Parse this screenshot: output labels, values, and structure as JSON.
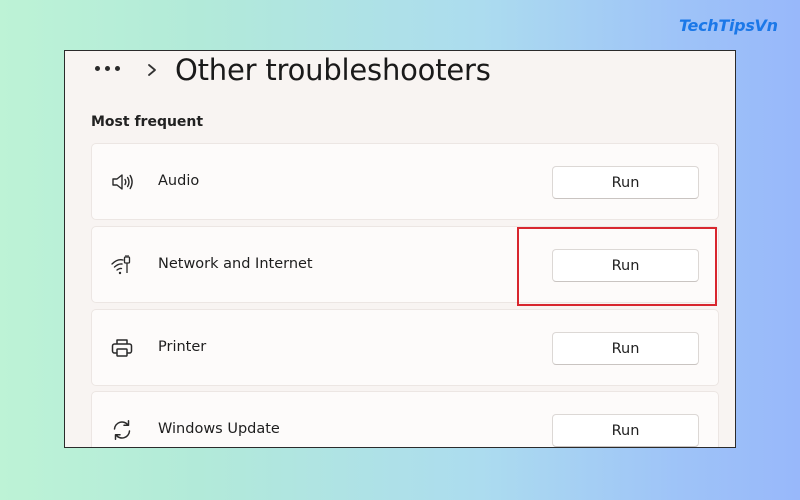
{
  "watermark": {
    "text": "TechTipsVn"
  },
  "header": {
    "more_icon": "more-dots-icon",
    "chevron_icon": "chevron-right-icon",
    "title": "Other troubleshooters"
  },
  "section": {
    "label": "Most frequent"
  },
  "items": [
    {
      "label": "Audio",
      "icon": "speaker-icon",
      "button": "Run"
    },
    {
      "label": "Network and Internet",
      "icon": "wifi-icon",
      "button": "Run"
    },
    {
      "label": "Printer",
      "icon": "printer-icon",
      "button": "Run"
    },
    {
      "label": "Windows Update",
      "icon": "refresh-icon",
      "button": "Run"
    }
  ],
  "colors": {
    "highlight": "#d8262e",
    "brand": "#1b78e8"
  }
}
